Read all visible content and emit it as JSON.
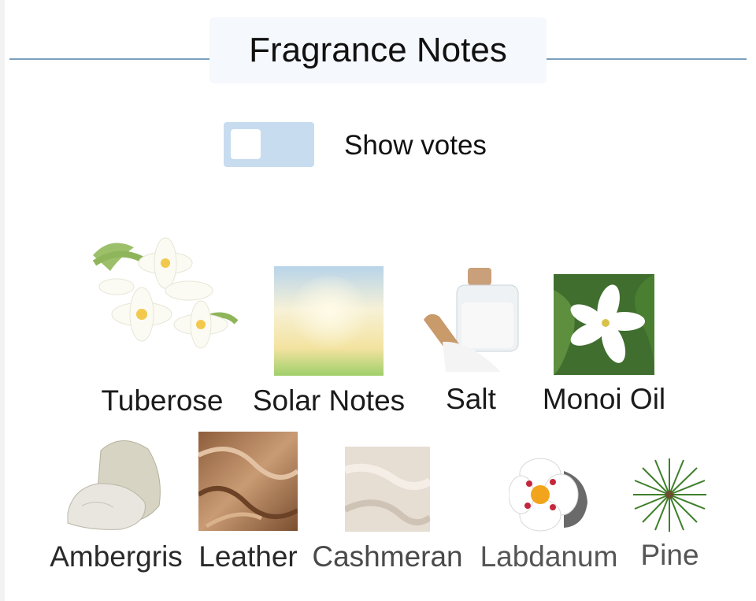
{
  "header": {
    "title": "Fragrance Notes"
  },
  "controls": {
    "show_votes_label": "Show votes",
    "show_votes_on": false
  },
  "notes": [
    {
      "label": "Tuberose",
      "color": "#1a1a1a",
      "icon": "tuberose-icon"
    },
    {
      "label": "Solar Notes",
      "color": "#1a1a1a",
      "icon": "solar-notes-icon"
    },
    {
      "label": "Salt",
      "color": "#1a1a1a",
      "icon": "salt-icon"
    },
    {
      "label": "Monoi Oil",
      "color": "#1a1a1a",
      "icon": "monoi-oil-icon"
    },
    {
      "label": "Ambergris",
      "color": "#2a2a2a",
      "icon": "ambergris-icon"
    },
    {
      "label": "Leather",
      "color": "#2a2a2a",
      "icon": "leather-icon"
    },
    {
      "label": "Cashmeran",
      "color": "#4a4a4a",
      "icon": "cashmeran-icon"
    },
    {
      "label": "Labdanum",
      "color": "#555555",
      "icon": "labdanum-icon"
    },
    {
      "label": "Pine",
      "color": "#555555",
      "icon": "pine-icon"
    }
  ]
}
